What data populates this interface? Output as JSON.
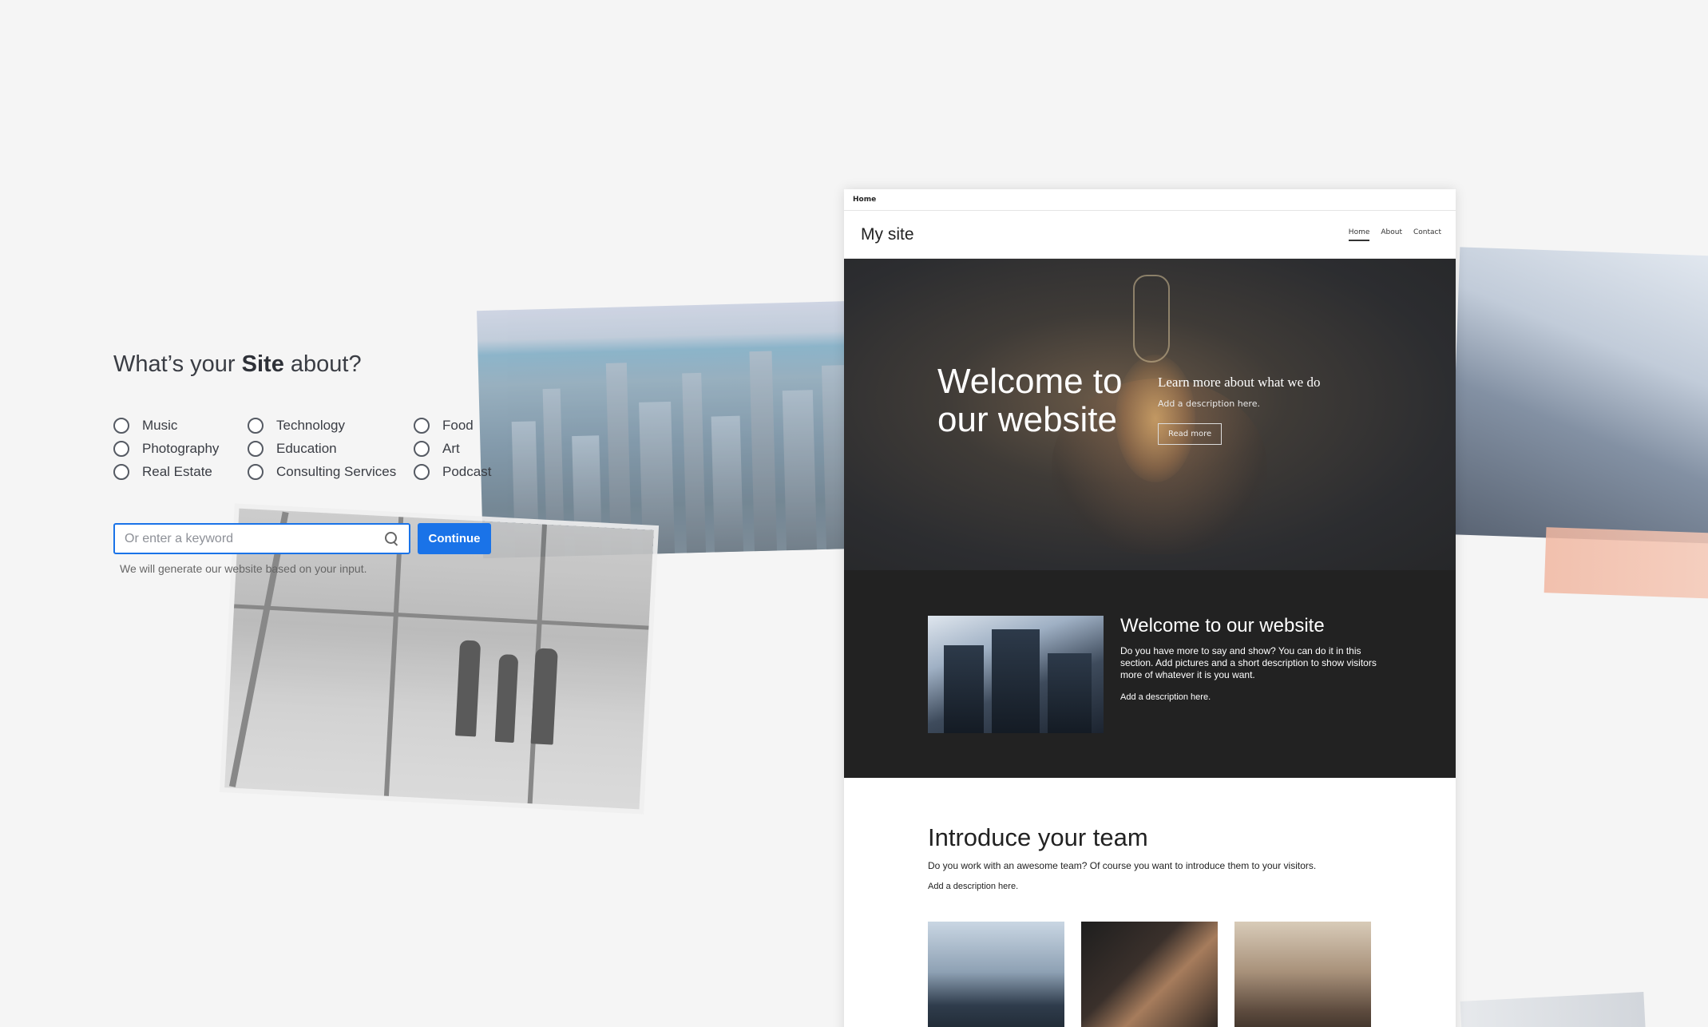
{
  "form": {
    "headline_prefix": "What’s your ",
    "headline_bold": "Site",
    "headline_suffix": " about?",
    "options": [
      "Music",
      "Technology",
      "Food",
      "Photography",
      "Education",
      "Art",
      "Real Estate",
      "Consulting Services",
      "Podcast"
    ],
    "keyword_placeholder": "Or enter a keyword",
    "continue_label": "Continue",
    "hint": "We will generate our website based on your input."
  },
  "preview": {
    "topbar_label": "Home",
    "logo": "My site",
    "nav": [
      "Home",
      "About",
      "Contact"
    ],
    "hero_title_line1": "Welcome to",
    "hero_title_line2": "our website",
    "hero_subtitle": "Learn more about what we do",
    "hero_description": "Add a description here.",
    "hero_button": "Read more",
    "section_title": "Welcome to our website",
    "section_body": "Do you have more to say and show? You can do it in this section. Add pictures and a short description to show visitors more of whatever it is you want.",
    "section_add": "Add a description here.",
    "team_title": "Introduce your team",
    "team_body": "Do you work with an awesome team? Of course you want to introduce them to your visitors.",
    "team_add": "Add a description here."
  },
  "colors": {
    "accent": "#1a73e8",
    "background": "#f5f5f5",
    "dark_section": "#222222"
  }
}
